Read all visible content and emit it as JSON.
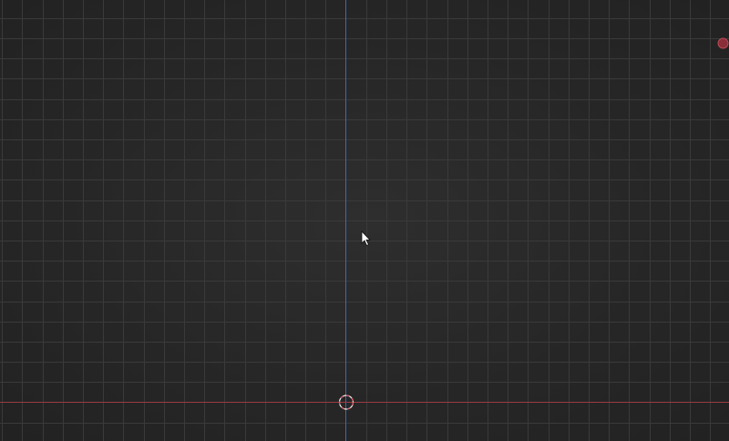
{
  "viewport": {
    "view": "3d-viewport-top-orthographic",
    "grid": true,
    "background_color": "#262626",
    "grid_color": "#3a3a3a"
  },
  "axes": {
    "x_axis_color": "#9b3a44",
    "z_axis_color": "#3e6aa8"
  },
  "cursor_3d": {
    "icon": "3d-cursor-icon",
    "ring_color": "#f0f0f0",
    "dash_color": "#d9545f"
  },
  "navigation_gizmo": {
    "icon": "x-axis-gizmo-dot-icon",
    "color": "#8a2f39"
  },
  "mouse_pointer": {
    "icon": "arrow-pointer-icon"
  }
}
